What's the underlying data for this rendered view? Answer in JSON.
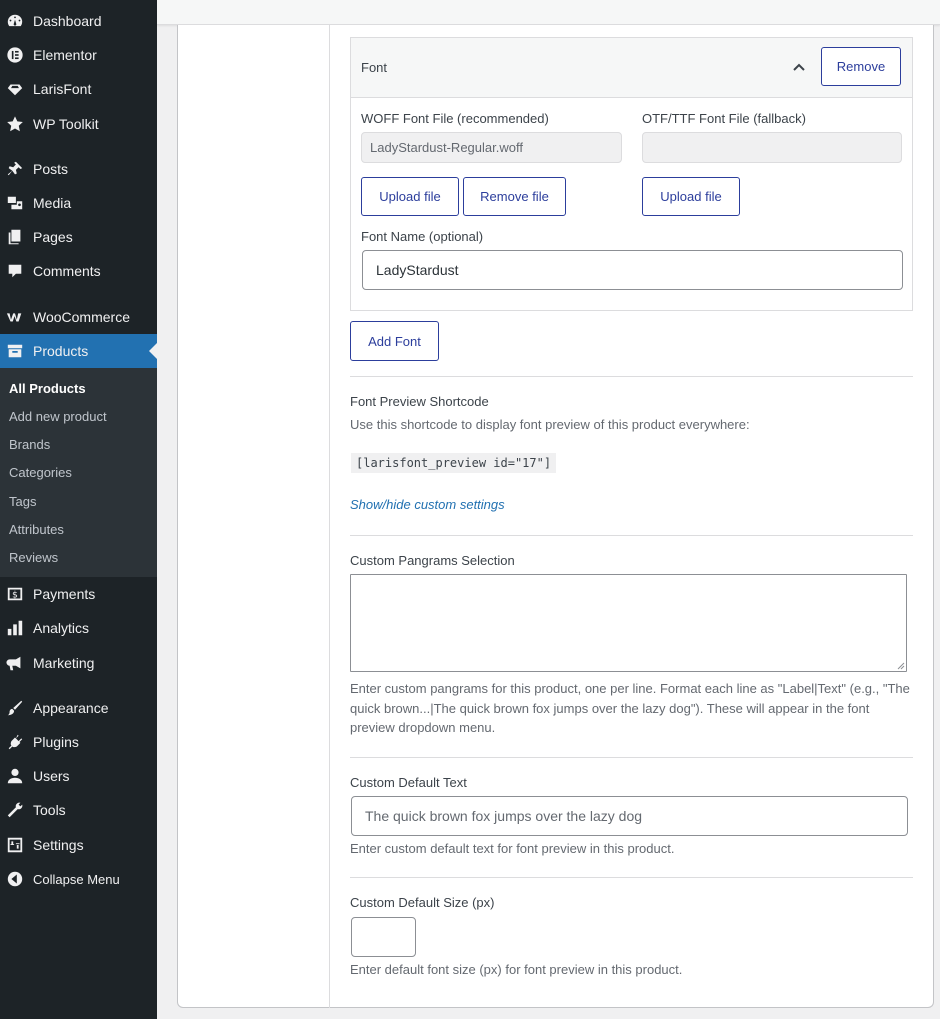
{
  "sidebar": {
    "items": [
      {
        "label": "Dashboard",
        "icon": "dashboard-icon"
      },
      {
        "label": "Elementor",
        "icon": "elementor-icon"
      },
      {
        "label": "LarisFont",
        "icon": "diamond-icon"
      },
      {
        "label": "WP Toolkit",
        "icon": "star-icon"
      },
      {
        "label": "Posts",
        "icon": "pin-icon"
      },
      {
        "label": "Media",
        "icon": "media-icon"
      },
      {
        "label": "Pages",
        "icon": "pages-icon"
      },
      {
        "label": "Comments",
        "icon": "comment-icon"
      },
      {
        "label": "WooCommerce",
        "icon": "woocommerce-icon"
      },
      {
        "label": "Products",
        "icon": "archive-icon"
      },
      {
        "label": "Payments",
        "icon": "payments-icon"
      },
      {
        "label": "Analytics",
        "icon": "bar-chart-icon"
      },
      {
        "label": "Marketing",
        "icon": "megaphone-icon"
      },
      {
        "label": "Appearance",
        "icon": "brush-icon"
      },
      {
        "label": "Plugins",
        "icon": "plugin-icon"
      },
      {
        "label": "Users",
        "icon": "user-icon"
      },
      {
        "label": "Tools",
        "icon": "wrench-icon"
      },
      {
        "label": "Settings",
        "icon": "settings-icon"
      },
      {
        "label": "Collapse Menu",
        "icon": "collapse-icon"
      }
    ],
    "submenu": [
      "All Products",
      "Add new product",
      "Brands",
      "Categories",
      "Tags",
      "Attributes",
      "Reviews"
    ]
  },
  "font_box": {
    "header_title": "Font",
    "remove_label": "Remove",
    "woff_label": "WOFF Font File (recommended)",
    "woff_value": "LadyStardust-Regular.woff",
    "otf_label": "OTF/TTF Font File (fallback)",
    "otf_value": "",
    "upload_label": "Upload file",
    "remove_file_label": "Remove file",
    "upload_label_2": "Upload file",
    "font_name_label": "Font Name (optional)",
    "font_name_value": "LadyStardust"
  },
  "add_font_label": "Add Font",
  "shortcode": {
    "title": "Font Preview Shortcode",
    "description": "Use this shortcode to display font preview of this product everywhere:",
    "code": "[larisfont_preview id=\"17\"]",
    "toggle_link": "Show/hide custom settings"
  },
  "pangrams": {
    "label": "Custom Pangrams Selection",
    "value": "",
    "help_line1": "Enter custom pangrams for this product, one per line. Format each line as \"Label|Text\" (e.g., \"The",
    "help_line2": "quick brown...|The quick brown fox jumps over the lazy dog\"). These will appear in the font",
    "help_line3": "preview dropdown menu."
  },
  "default_text": {
    "label": "Custom Default Text",
    "placeholder": "The quick brown fox jumps over the lazy dog",
    "help": "Enter custom default text for font preview in this product."
  },
  "default_size": {
    "label": "Custom Default Size (px)",
    "value": "",
    "help": "Enter default font size (px) for font preview in this product."
  }
}
